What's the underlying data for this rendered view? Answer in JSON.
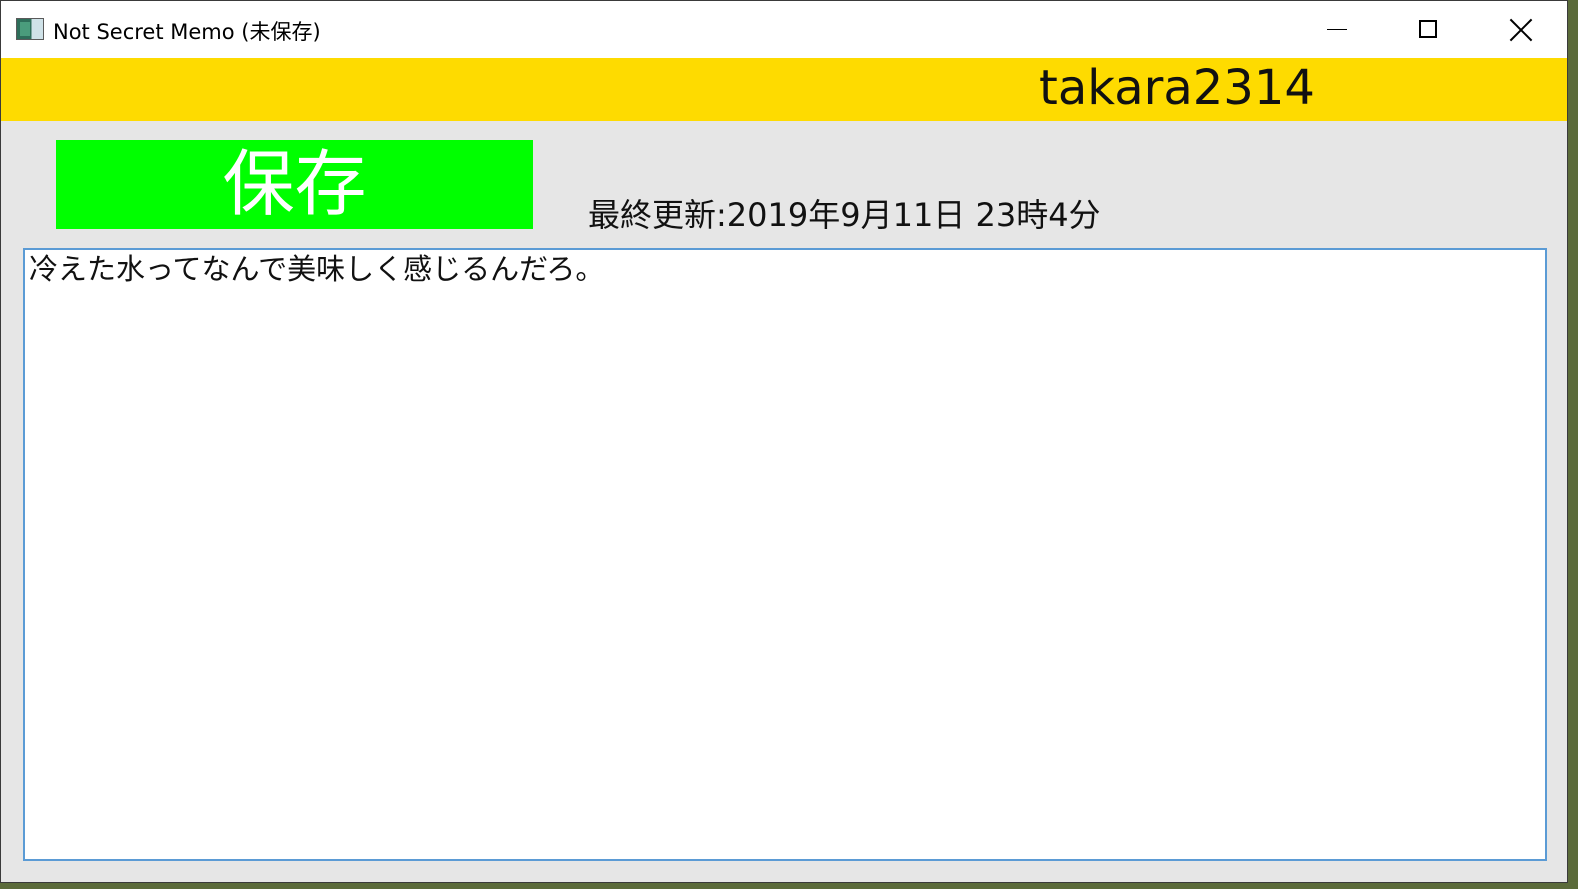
{
  "window": {
    "title": "Not Secret Memo (未保存)",
    "icon": "app-icon"
  },
  "titlebar_controls": {
    "minimize": "minimize-icon",
    "maximize": "maximize-icon",
    "close": "close-icon"
  },
  "header": {
    "username": "takara2314",
    "background_color": "#fedb00"
  },
  "toolbar": {
    "save_label": "保存",
    "save_color": "#00ff00",
    "last_updated": "最終更新:2019年9月11日 23時4分"
  },
  "memo": {
    "content": "冷えた水ってなんで美味しく感じるんだろ。"
  }
}
